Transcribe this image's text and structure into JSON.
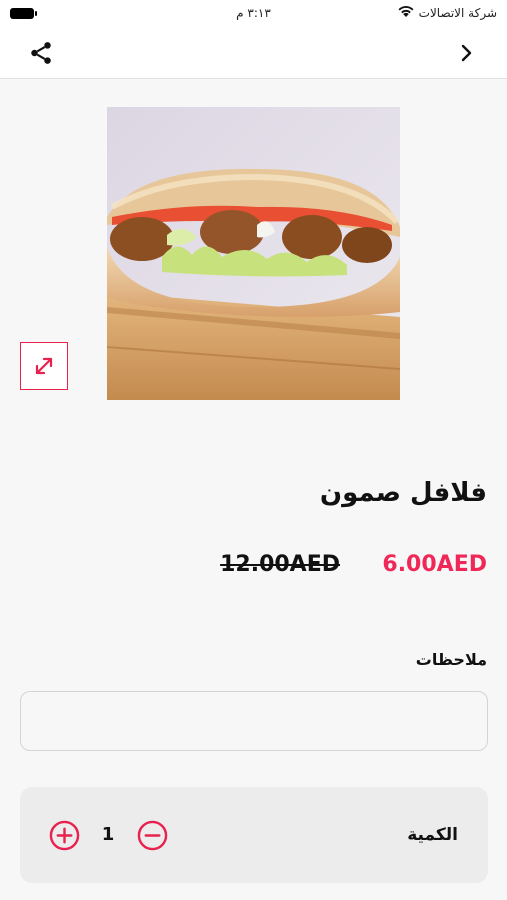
{
  "status_bar": {
    "carrier": "شركة الاتصالات",
    "time": "٣:١٣ م",
    "wifi_icon": "wifi-icon",
    "battery_icon": "battery-icon"
  },
  "nav": {
    "back_icon": "chevron-right-icon",
    "share_icon": "share-icon"
  },
  "product": {
    "image_alt": "falafel sandwich",
    "expand_icon": "expand-icon",
    "title": "فلافل صمون",
    "price_current": "6.00AED",
    "price_old": "12.00AED"
  },
  "notes": {
    "label": "ملاحظات",
    "value": "",
    "placeholder": ""
  },
  "quantity": {
    "label": "الكمية",
    "value": "1",
    "plus_icon": "plus-circle-icon",
    "minus_icon": "minus-circle-icon"
  },
  "colors": {
    "accent": "#ef2857",
    "background": "#f7f7f7",
    "card": "#ececec"
  }
}
